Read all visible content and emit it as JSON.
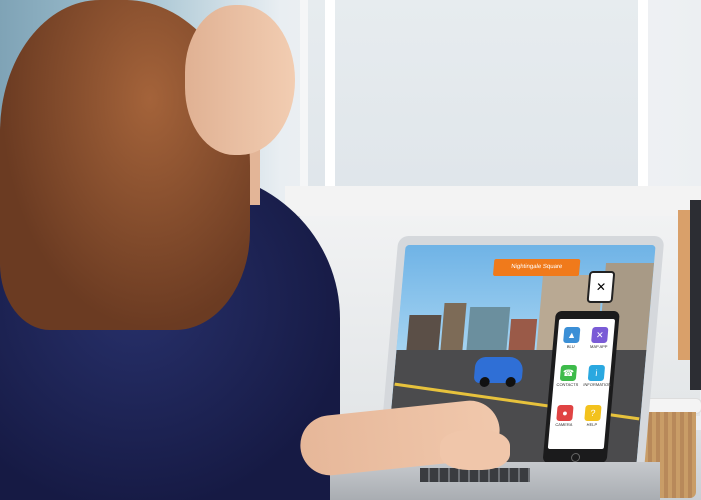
{
  "game": {
    "location_banner": "Nightingale Square",
    "phone_apps": [
      {
        "label": "BLU",
        "icon": "blue-app-icon",
        "color": "#3b8fd6"
      },
      {
        "label": "MAP APP",
        "icon": "map-app-icon",
        "color": "#7a5bd6"
      },
      {
        "label": "CONTACTS",
        "icon": "contacts-app-icon",
        "color": "#3dbb4a"
      },
      {
        "label": "INFORMATION",
        "icon": "info-app-icon",
        "color": "#2aa8e0"
      },
      {
        "label": "CAMERA",
        "icon": "camera-app-icon",
        "color": "#e04343"
      },
      {
        "label": "HELP",
        "icon": "help-app-icon",
        "color": "#f3c21d"
      }
    ]
  },
  "colors": {
    "banner": "#f07a1b",
    "car": "#2f6fd6",
    "shirt": "#1e2456"
  }
}
